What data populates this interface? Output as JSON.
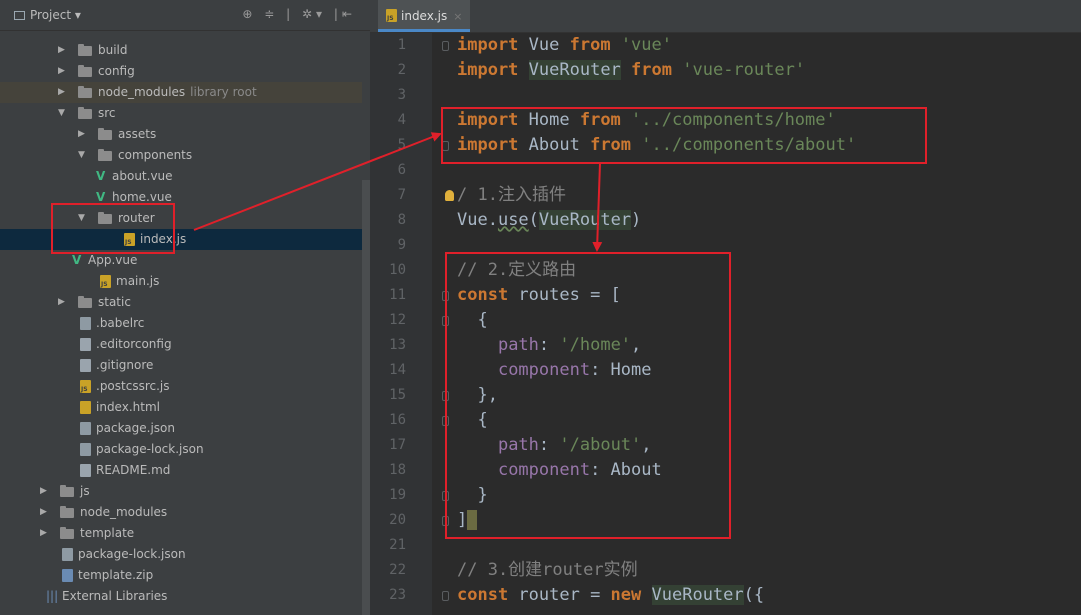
{
  "sidebar": {
    "header_label": "Project ▾",
    "header_tools": "⊕ ≑ | ✲▾ |⇤",
    "tree": [
      {
        "label": "build",
        "type": "folder",
        "indent": 1,
        "state": "collapsed"
      },
      {
        "label": "config",
        "type": "folder",
        "indent": 1,
        "state": "collapsed"
      },
      {
        "label": "node_modules",
        "type": "folder",
        "indent": 1,
        "state": "collapsed",
        "note": "library root"
      },
      {
        "label": "src",
        "type": "folder",
        "indent": 1,
        "state": "expanded"
      },
      {
        "label": "assets",
        "type": "folder",
        "indent": 2,
        "state": "collapsed"
      },
      {
        "label": "components",
        "type": "folder",
        "indent": 2,
        "state": "expanded"
      },
      {
        "label": "about.vue",
        "type": "vue",
        "indent": 3
      },
      {
        "label": "home.vue",
        "type": "vue",
        "indent": 3
      },
      {
        "label": "router",
        "type": "folder",
        "indent": 2,
        "state": "expanded"
      },
      {
        "label": "index.js",
        "type": "js",
        "indent": 3,
        "selected": true
      },
      {
        "label": "App.vue",
        "type": "vue",
        "indent": 2
      },
      {
        "label": "main.js",
        "type": "js",
        "indent": 2
      },
      {
        "label": "static",
        "type": "folder",
        "indent": 1,
        "state": "collapsed"
      },
      {
        "label": ".babelrc",
        "type": "cfg",
        "indent": 1
      },
      {
        "label": ".editorconfig",
        "type": "gen",
        "indent": 1
      },
      {
        "label": ".gitignore",
        "type": "gen",
        "indent": 1
      },
      {
        "label": ".postcssrc.js",
        "type": "js",
        "indent": 1
      },
      {
        "label": "index.html",
        "type": "html",
        "indent": 1
      },
      {
        "label": "package.json",
        "type": "cfg",
        "indent": 1
      },
      {
        "label": "package-lock.json",
        "type": "cfg",
        "indent": 1
      },
      {
        "label": "README.md",
        "type": "gen",
        "indent": 1
      },
      {
        "label": "js",
        "type": "folder",
        "indent": 0,
        "state": "collapsed"
      },
      {
        "label": "node_modules",
        "type": "folder",
        "indent": 0,
        "state": "collapsed"
      },
      {
        "label": "template",
        "type": "folder",
        "indent": 0,
        "state": "collapsed"
      },
      {
        "label": "package-lock.json",
        "type": "cfg",
        "indent": 0
      },
      {
        "label": "template.zip",
        "type": "zip",
        "indent": 0
      },
      {
        "label": "External Libraries",
        "type": "lib",
        "indent": 0
      }
    ]
  },
  "editor": {
    "tab_label": "index.js",
    "tab_close": "×",
    "lines": [
      {
        "n": "1",
        "html": "<span class=\"kw\">import</span> Vue <span class=\"kw\">from</span> <span class=\"str\">'vue'</span>",
        "fold": true
      },
      {
        "n": "2",
        "html": "<span class=\"kw\">import</span> <span class=\"hlbg\">VueRouter</span> <span class=\"kw\">from</span> <span class=\"str\">'vue-router'</span>"
      },
      {
        "n": "3",
        "html": ""
      },
      {
        "n": "4",
        "html": "<span class=\"kw\">import</span> Home <span class=\"kw\">from</span> <span class=\"str\">'../components/home'</span>"
      },
      {
        "n": "5",
        "html": "<span class=\"kw\">import</span> About <span class=\"kw\">from</span> <span class=\"str\">'../components/about'</span>",
        "fold": true
      },
      {
        "n": "6",
        "html": ""
      },
      {
        "n": "7",
        "html": "<span class=\"bulb\"></span><span class=\"cm\">/ 1.注入插件</span>"
      },
      {
        "n": "8",
        "html": "Vue.<span class=\"under\">use</span>(<span class=\"hlbg\">VueRouter</span>)"
      },
      {
        "n": "9",
        "html": ""
      },
      {
        "n": "10",
        "html": "<span class=\"cm\">// 2.定义路由</span>"
      },
      {
        "n": "11",
        "html": "<span class=\"kw\">const</span> routes = [",
        "fold": true
      },
      {
        "n": "12",
        "html": "  {",
        "fold": true
      },
      {
        "n": "13",
        "html": "    <span class=\"prop\">path</span>: <span class=\"str\">'/home'</span>,"
      },
      {
        "n": "14",
        "html": "    <span class=\"prop\">component</span>: Home"
      },
      {
        "n": "15",
        "html": "  },",
        "fold": true
      },
      {
        "n": "16",
        "html": "  {",
        "fold": true
      },
      {
        "n": "17",
        "html": "    <span class=\"prop\">path</span>: <span class=\"str\">'/about'</span>,"
      },
      {
        "n": "18",
        "html": "    <span class=\"prop\">component</span>: About"
      },
      {
        "n": "19",
        "html": "  }",
        "fold": true
      },
      {
        "n": "20",
        "html": "]<span class=\"caretmark\"></span>",
        "fold": true
      },
      {
        "n": "21",
        "html": ""
      },
      {
        "n": "22",
        "html": "<span class=\"cm\">// 3.创建router实例</span>"
      },
      {
        "n": "23",
        "html": "<span class=\"kw\">const</span> router = <span class=\"kw\">new</span> <span class=\"hlbg\">VueRouter</span>({",
        "fold": true
      }
    ]
  },
  "annotations": {
    "color": "#e0202a",
    "boxes": [
      "router-folder-box",
      "import-box",
      "routes-box"
    ]
  }
}
